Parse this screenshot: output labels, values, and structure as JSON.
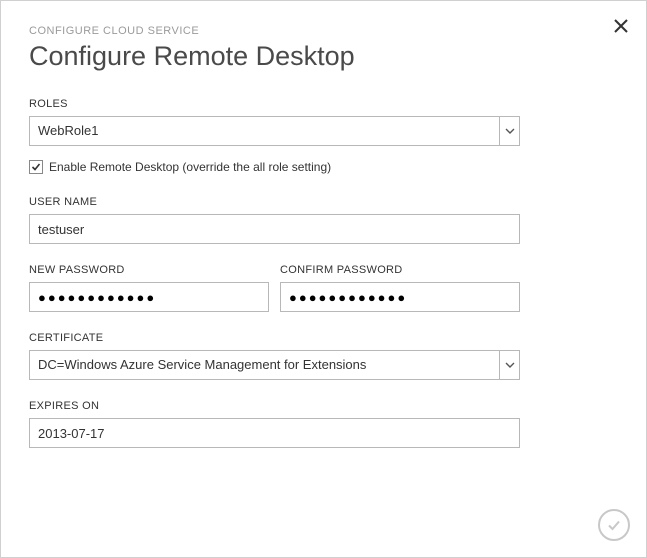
{
  "header": {
    "breadcrumb": "CONFIGURE CLOUD SERVICE",
    "title": "Configure Remote Desktop"
  },
  "roles": {
    "label": "ROLES",
    "selected": "WebRole1"
  },
  "enable_checkbox": {
    "checked": true,
    "label": "Enable Remote Desktop (override the all role setting)"
  },
  "username": {
    "label": "USER NAME",
    "value": "testuser"
  },
  "new_password": {
    "label": "NEW PASSWORD",
    "value": "●●●●●●●●●●●●"
  },
  "confirm_password": {
    "label": "CONFIRM PASSWORD",
    "value": "●●●●●●●●●●●●"
  },
  "certificate": {
    "label": "CERTIFICATE",
    "selected": "DC=Windows Azure Service Management for Extensions"
  },
  "expires": {
    "label": "EXPIRES ON",
    "value": "2013-07-17"
  }
}
